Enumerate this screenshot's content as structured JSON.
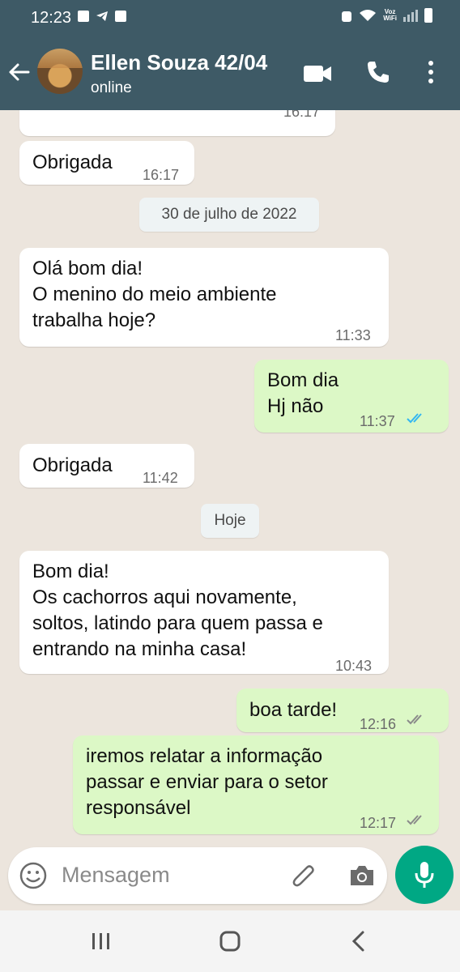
{
  "status_bar": {
    "time": "12:23",
    "network_label": "Voz\nWiFi"
  },
  "header": {
    "contact_name": "Ellen Souza 42/04",
    "status": "online"
  },
  "messages": [
    {
      "dir": "in",
      "text": "",
      "time": "16:17"
    },
    {
      "dir": "in",
      "text": "Obrigada",
      "time": "16:17"
    },
    {
      "dir": "in",
      "text": "Olá bom dia!\nO menino do meio ambiente\ntrabalha hoje?",
      "time": "11:33"
    },
    {
      "dir": "out",
      "text": "Bom dia\nHj não",
      "time": "11:37",
      "ticks": "read"
    },
    {
      "dir": "in",
      "text": "Obrigada",
      "time": "11:42"
    },
    {
      "dir": "in",
      "text": "Bom dia!\nOs cachorros aqui novamente,\nsoltos, latindo para quem passa e\nentrando na minha casa!",
      "time": "10:43"
    },
    {
      "dir": "out",
      "text": "boa tarde!",
      "time": "12:16",
      "ticks": "delivered"
    },
    {
      "dir": "out",
      "text": "iremos relatar a informação\npassar e enviar para o setor\nresponsável",
      "time": "12:17",
      "ticks": "delivered"
    }
  ],
  "date_separators": [
    "30 de julho de 2022",
    "Hoje"
  ],
  "input": {
    "placeholder": "Mensagem"
  },
  "colors": {
    "header": "#3e5a66",
    "chat_bg": "#ece5dd",
    "out_bubble": "#dcf8c6",
    "accent": "#00a884",
    "read_ticks": "#34b7f1"
  },
  "icons": [
    "back-arrow-icon",
    "video-call-icon",
    "phone-icon",
    "more-vert-icon",
    "emoji-icon",
    "attach-icon",
    "camera-icon",
    "mic-icon"
  ]
}
